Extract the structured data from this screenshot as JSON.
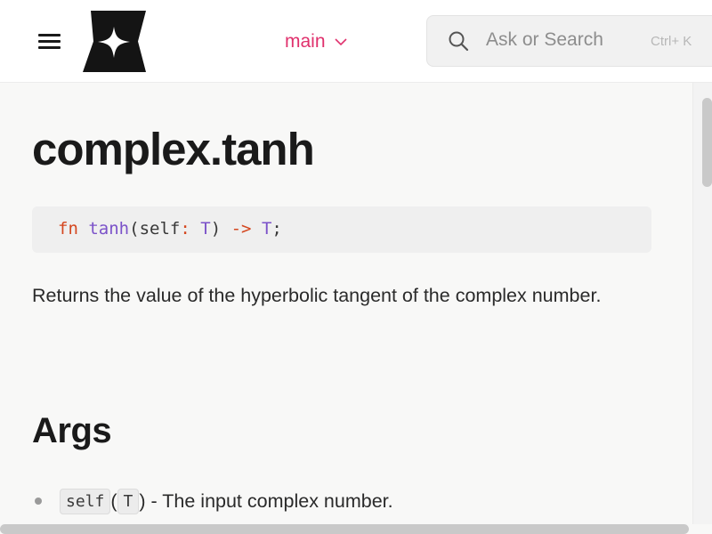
{
  "header": {
    "menu_icon": "hamburger-menu-icon",
    "logo_icon": "four-point-star-logo-icon",
    "branch": {
      "label": "main",
      "icon": "chevron-down-icon",
      "color": "#e0316d"
    },
    "search": {
      "placeholder": "Ask or Search",
      "shortcut": "Ctrl+ K",
      "icon": "search-icon"
    }
  },
  "page": {
    "title": "complex.tanh",
    "signature": {
      "keyword": "fn",
      "name": "tanh",
      "open": "(",
      "param": "self",
      "colon": ":",
      "param_type": "T",
      "close": ")",
      "arrow": "->",
      "return_type": "T",
      "semicolon": ";"
    },
    "description": "Returns the value of the hyperbolic tangent of the complex number.",
    "args_heading": "Args",
    "args": [
      {
        "name": "self",
        "open": "(",
        "type": "T",
        "close": ")",
        "text": " - The input complex number."
      }
    ]
  },
  "colors": {
    "keyword": "#d4471f",
    "type": "#7b52c9",
    "accent": "#e0316d"
  }
}
